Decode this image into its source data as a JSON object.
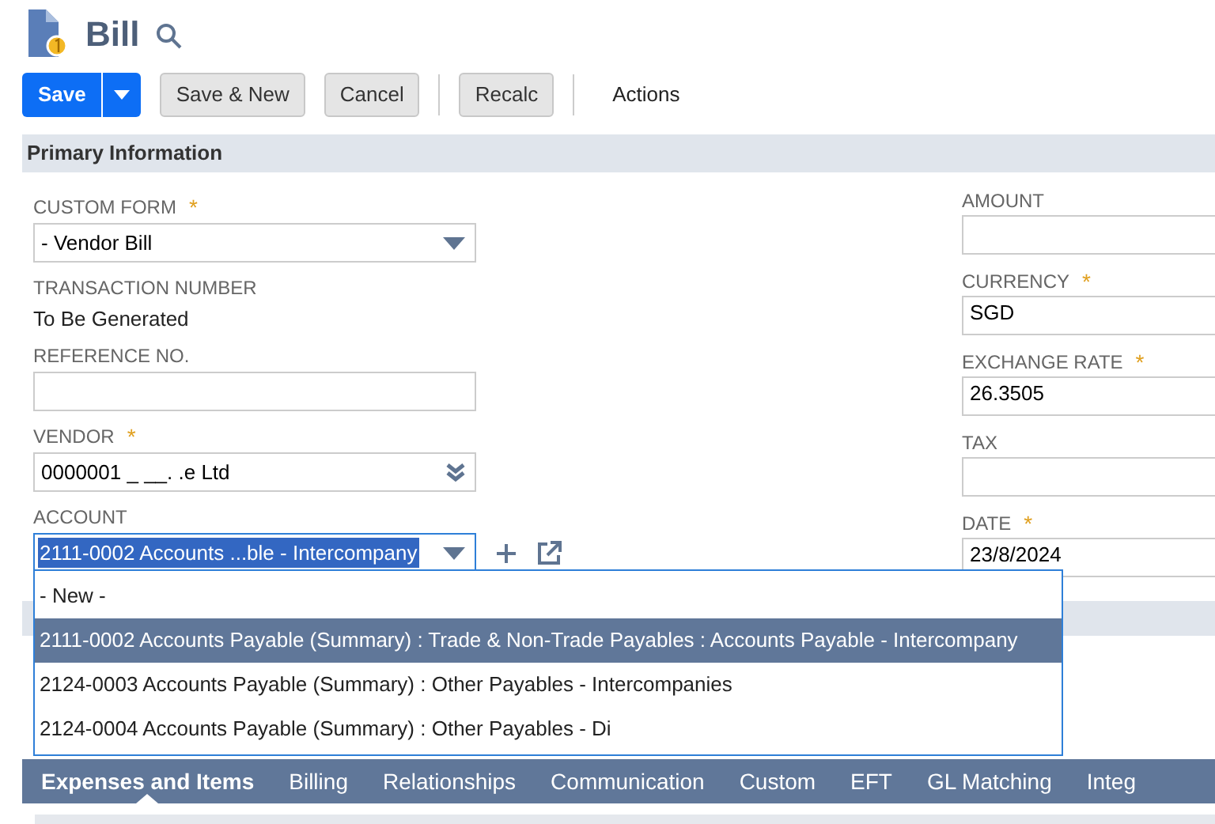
{
  "page": {
    "title": "Bill"
  },
  "required_marker": "*",
  "toolbar": {
    "buttons": [
      {
        "label": "Save",
        "kind": "primary"
      },
      {
        "label": "Save & New",
        "kind": "secondary"
      },
      {
        "label": "Cancel",
        "kind": "secondary"
      },
      {
        "label": "Recalc",
        "kind": "secondary"
      },
      {
        "label": "Actions",
        "kind": "menu"
      }
    ]
  },
  "section": {
    "title": "Primary Information"
  },
  "left_fields": [
    {
      "label": "CUSTOM FORM",
      "required": true,
      "kind": "select",
      "value": "- Vendor Bill"
    },
    {
      "label": "TRANSACTION NUMBER",
      "required": false,
      "kind": "text",
      "value": "To Be Generated"
    },
    {
      "label": "REFERENCE NO.",
      "required": false,
      "kind": "input"
    },
    {
      "label": "VENDOR",
      "required": true,
      "kind": "multiselect",
      "value": "0000001 _ __. .e Ltd"
    },
    {
      "label": "ACCOUNT",
      "required": false,
      "kind": "active",
      "value": "2111-0002 Accounts ...ble - Intercompany"
    }
  ],
  "right_fields": [
    {
      "label": "AMOUNT",
      "required": false
    },
    {
      "label": "CURRENCY",
      "required": true,
      "value": "SGD"
    },
    {
      "label": "EXCHANGE RATE",
      "required": true,
      "value": "26.3505"
    },
    {
      "label": "TAX",
      "required": false
    },
    {
      "label": "DATE",
      "required": true,
      "value": "23/8/2024"
    }
  ],
  "account_dropdown": {
    "options": [
      {
        "label": "- New -",
        "selected": false
      },
      {
        "label": "2111-0002 Accounts Payable (Summary) : Trade & Non-Trade Payables : Accounts Payable - Intercompany",
        "selected": true
      },
      {
        "label": "2124-0003 Accounts Payable (Summary) : Other Payables - Intercompanies",
        "selected": false
      },
      {
        "label": "2124-0004 Accounts Payable (Summary) : Other Payables - Di",
        "selected": false
      }
    ]
  },
  "tabs": [
    {
      "label": "Expenses and Items",
      "selected": true
    },
    {
      "label": "Billing",
      "selected": false
    },
    {
      "label": "Relationships",
      "selected": false
    },
    {
      "label": "Communication",
      "selected": false
    },
    {
      "label": "Custom",
      "selected": false
    },
    {
      "label": "EFT",
      "selected": false
    },
    {
      "label": "GL Matching",
      "selected": false
    },
    {
      "label": "Integ",
      "selected": false
    }
  ]
}
